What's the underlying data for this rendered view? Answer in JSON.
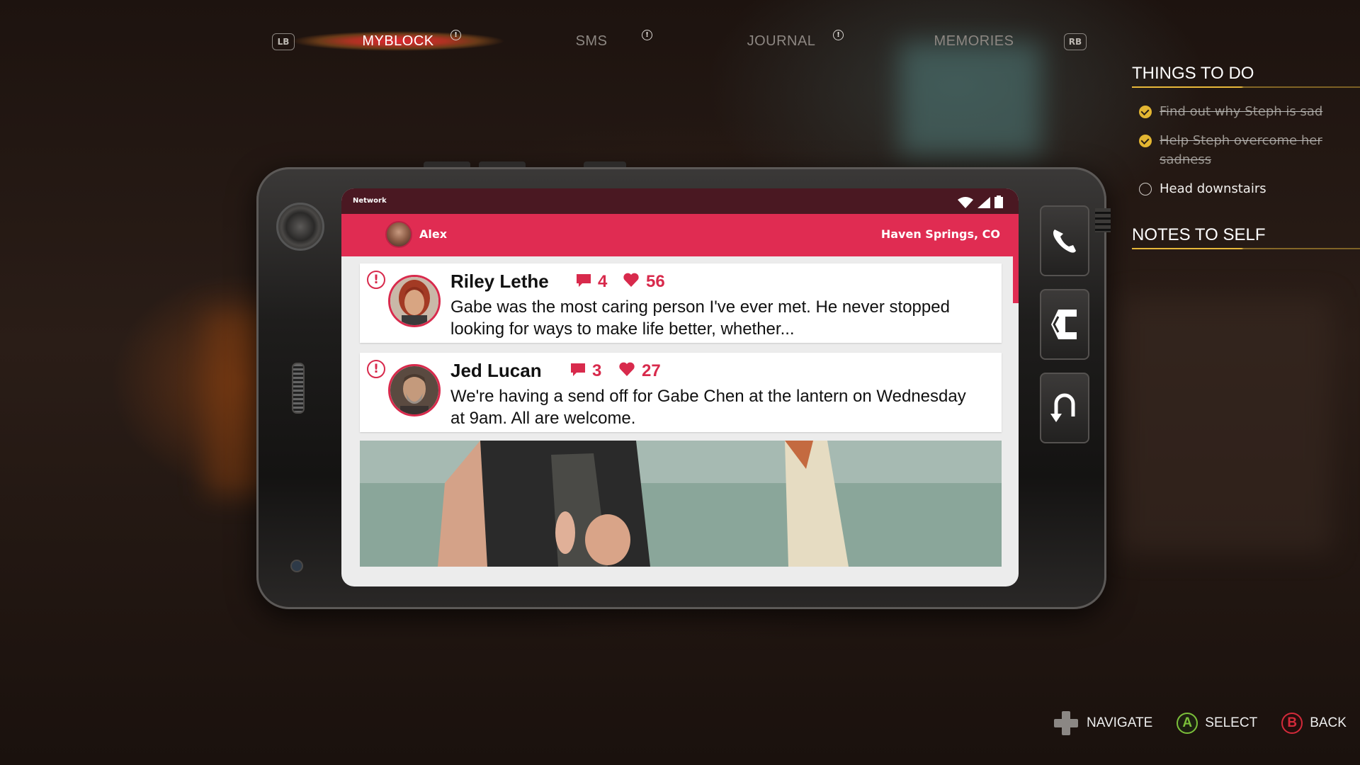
{
  "tabs": {
    "left_bumper": "LB",
    "right_bumper": "RB",
    "items": [
      {
        "label": "MYBLOCK",
        "active": true,
        "alert": true
      },
      {
        "label": "SMS",
        "active": false,
        "alert": true
      },
      {
        "label": "JOURNAL",
        "active": false,
        "alert": true
      },
      {
        "label": "MEMORIES",
        "active": false,
        "alert": false
      }
    ],
    "alert_glyph": "!"
  },
  "side_panel": {
    "todo_title": "THINGS TO DO",
    "tasks": [
      {
        "text": "Find out why Steph is sad",
        "done": true
      },
      {
        "text": "Help Steph overcome her sadness",
        "done": true
      },
      {
        "text": "Head downstairs",
        "done": false
      }
    ],
    "notes_title": "NOTES TO SELF"
  },
  "phone": {
    "status_bar": {
      "network_label": "Network",
      "icons": [
        "wifi-icon",
        "signal-icon",
        "battery-icon"
      ]
    },
    "app_bar": {
      "user_name": "Alex",
      "location": "Haven Springs, CO"
    },
    "posts": [
      {
        "author": "Riley Lethe",
        "comments": "4",
        "likes": "56",
        "text": "Gabe was the most caring person I've ever met. He never stopped looking for ways to make life better, whether...",
        "alert_glyph": "!"
      },
      {
        "author": "Jed Lucan",
        "comments": "3",
        "likes": "27",
        "text": "We're having a send off for Gabe Chen at the lantern on Wednesday at 9am. All are welcome.",
        "alert_glyph": "!"
      }
    ],
    "side_buttons": [
      "phone-call-icon",
      "myblock-app-icon",
      "back-arrow-icon"
    ]
  },
  "hints": {
    "navigate": "NAVIGATE",
    "select": "SELECT",
    "back": "BACK",
    "a_glyph": "A",
    "b_glyph": "B"
  },
  "colors": {
    "accent": "#e02c52",
    "status_bar": "#4a1822",
    "task_done": "#e3b632",
    "button_a": "#7bbf3a",
    "button_b": "#d22a3a"
  }
}
